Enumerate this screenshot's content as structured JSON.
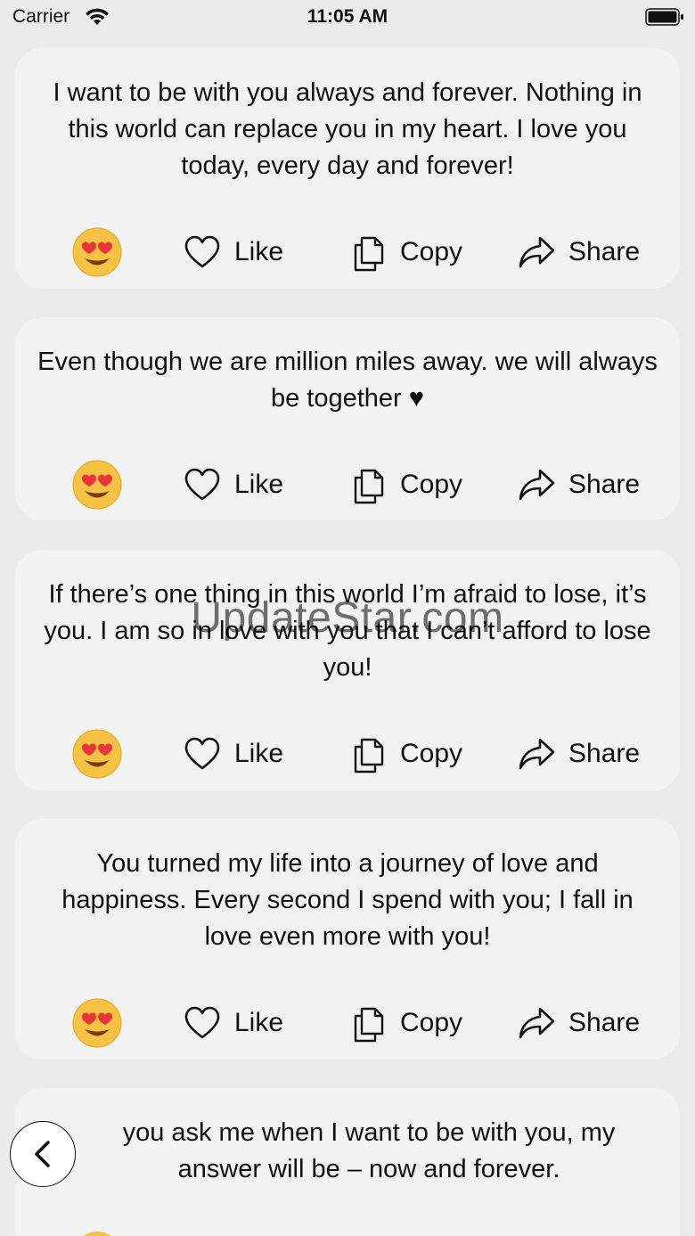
{
  "status_bar": {
    "carrier": "Carrier",
    "time": "11:05 AM",
    "wifi_icon": "wifi-icon",
    "battery_icon": "battery-icon"
  },
  "actions": {
    "like_label": "Like",
    "copy_label": "Copy",
    "share_label": "Share",
    "emoji_icon": "heart-eyes-emoji",
    "like_icon": "heart-outline-icon",
    "copy_icon": "copy-icon",
    "share_icon": "share-arrow-icon"
  },
  "quotes": [
    {
      "text": "I want to be with you always and forever. Nothing in this world can replace you in my heart. I love you today, every day and forever!"
    },
    {
      "text": "Even though we are million miles away. we will always be together ♥"
    },
    {
      "text": "If there’s one thing in this world I’m afraid to lose, it’s you. I am so in love with you that I can’t afford to lose you!"
    },
    {
      "text": "You turned my life into a journey of love and happiness. Every second I spend with you; I fall in love even more with you!"
    },
    {
      "text": "you ask me when I want to be with you, my answer will be – now and forever."
    }
  ],
  "watermark": "UpdateStar.com",
  "colors": {
    "background": "#ebebeb",
    "card": "#f2f2f2",
    "text": "#111111"
  }
}
